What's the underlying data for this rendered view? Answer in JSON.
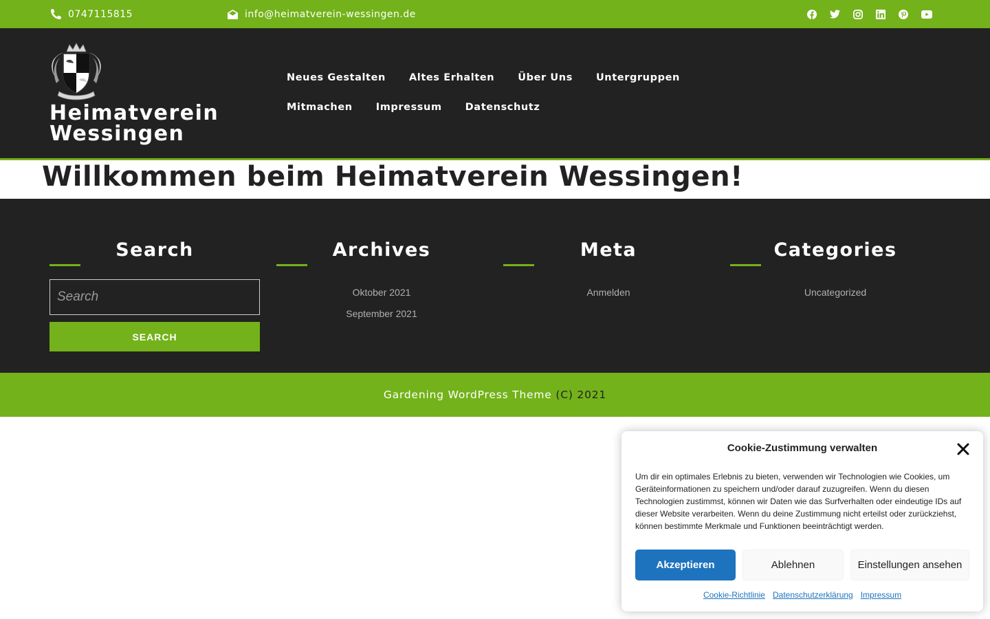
{
  "topbar": {
    "phone": "0747115815",
    "email": "info@heimatverein-wessingen.de",
    "socials": [
      "facebook-icon",
      "twitter-icon",
      "instagram-icon",
      "linkedin-icon",
      "pinterest-icon",
      "youtube-icon"
    ],
    "bg_color": "#73b21a"
  },
  "header": {
    "site_title_line1": "Heimatverein",
    "site_title_line2": "Wessingen",
    "nav": [
      {
        "label": "Neues Gestalten"
      },
      {
        "label": "Altes Erhalten"
      },
      {
        "label": "Über Uns"
      },
      {
        "label": "Untergruppen"
      },
      {
        "label": "Mitmachen"
      },
      {
        "label": "Impressum"
      },
      {
        "label": "Datenschutz"
      }
    ],
    "bg_color": "#222222"
  },
  "page": {
    "title": "Willkommen beim Heimatverein Wessingen!"
  },
  "widgets": {
    "search": {
      "title": "Search",
      "placeholder": "Search",
      "button": "SEARCH"
    },
    "archives": {
      "title": "Archives",
      "items": [
        "Oktober 2021",
        "September 2021"
      ]
    },
    "meta": {
      "title": "Meta",
      "items": [
        "Anmelden"
      ]
    },
    "categories": {
      "title": "Categories",
      "items": [
        "Uncategorized"
      ]
    }
  },
  "footer": {
    "theme_link": "Gardening WordPress Theme",
    "copyright": "(C) 2021"
  },
  "cookie": {
    "title": "Cookie-Zustimmung verwalten",
    "text": "Um dir ein optimales Erlebnis zu bieten, verwenden wir Technologien wie Cookies, um Geräteinformationen zu speichern und/oder darauf zuzugreifen. Wenn du diesen Technologien zustimmst, können wir Daten wie das Surfverhalten oder eindeutige IDs auf dieser Website verarbeiten. Wenn du deine Zustimmung nicht erteilst oder zurückziehst, können bestimmte Merkmale und Funktionen beeinträchtigt werden.",
    "accept": "Akzeptieren",
    "deny": "Ablehnen",
    "preferences": "Einstellungen ansehen",
    "links": [
      "Cookie-Richtlinie",
      "Datenschutzerklärung",
      "Impressum"
    ],
    "accent_color": "#1e73be"
  }
}
